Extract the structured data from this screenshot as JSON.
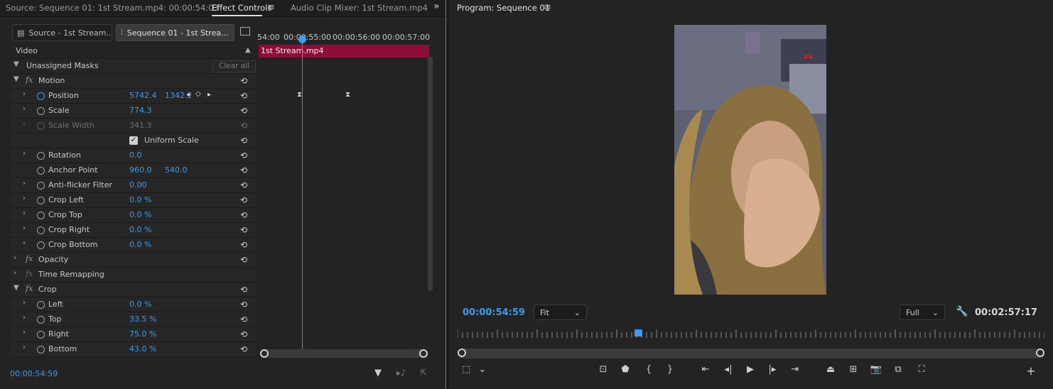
{
  "tabs": {
    "source": "Source: Sequence 01: 1st Stream.mp4: 00:00:54:03",
    "effect_controls": "Effect Controls",
    "audio_mixer": "Audio Clip Mixer: 1st Stream.mp4",
    "overflow": "»"
  },
  "source_buttons": {
    "source_clip": "Source - 1st Stream...",
    "sequence_clip": "Sequence 01 - 1st Strea..."
  },
  "sections": {
    "video": "Video",
    "unassigned_masks": "Unassigned Masks",
    "clear_all": "Clear all",
    "motion": "Motion",
    "opacity": "Opacity",
    "time_remapping": "Time Remapping",
    "crop": "Crop"
  },
  "motion": {
    "position": {
      "label": "Position",
      "x": "5742.4",
      "y": "1342.2"
    },
    "scale": {
      "label": "Scale",
      "value": "774.3"
    },
    "scale_width": {
      "label": "Scale Width",
      "value": "341.3"
    },
    "uniform_scale": {
      "label": "Uniform Scale",
      "checked": true
    },
    "rotation": {
      "label": "Rotation",
      "value": "0.0"
    },
    "anchor_point": {
      "label": "Anchor Point",
      "x": "960.0",
      "y": "540.0"
    },
    "anti_flicker": {
      "label": "Anti-flicker Filter",
      "value": "0.00"
    },
    "crop_left": {
      "label": "Crop Left",
      "value": "0.0 %"
    },
    "crop_top": {
      "label": "Crop Top",
      "value": "0.0 %"
    },
    "crop_right": {
      "label": "Crop Right",
      "value": "0.0 %"
    },
    "crop_bottom": {
      "label": "Crop Bottom",
      "value": "0.0 %"
    }
  },
  "crop": {
    "left": {
      "label": "Left",
      "value": "0.0 %"
    },
    "top": {
      "label": "Top",
      "value": "33.5 %"
    },
    "right": {
      "label": "Right",
      "value": "75.0 %"
    },
    "bottom": {
      "label": "Bottom",
      "value": "43.0 %"
    }
  },
  "timeline": {
    "ticks": [
      "54:00",
      "00:00:55:00",
      "00:00:56:00",
      "00:00:57:00"
    ],
    "clip_name": "1st Stream.mp4"
  },
  "effect_controls_timecode": "00:00:54:59",
  "program": {
    "title": "Program: Sequence 01",
    "timecode": "00:00:54:59",
    "duration": "00:02:57:17",
    "zoom": "Fit",
    "resolution": "Full"
  },
  "colors": {
    "accent": "#3c9cf0",
    "clip": "#8e0d38",
    "panel": "#232323"
  }
}
